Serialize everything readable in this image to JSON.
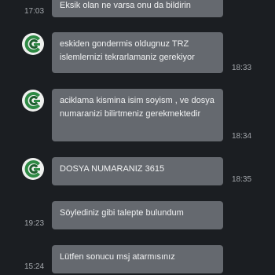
{
  "messages": [
    {
      "direction": "outgoing",
      "text": "Eksik olan ne varsa onu da bildirin",
      "time": "17:03"
    },
    {
      "direction": "incoming",
      "text": "eskiden gondermis oldugnuz TRZ islemlernizi tekrarlamaniz gerekiyor",
      "time": "18:33"
    },
    {
      "direction": "incoming",
      "text": "aciklama kismina isim soyism , ve dosya numaranizi bilirtmeniz gerekmektedir",
      "time": "18:34"
    },
    {
      "direction": "incoming",
      "text": "DOSYA NUMARANIZ 3615",
      "time": "18:35"
    },
    {
      "direction": "outgoing",
      "text": "Söylediniz gibi talepte bulundum",
      "time": "19:23"
    },
    {
      "direction": "outgoing",
      "text": "Lütfen sonucu msj atarmısınız",
      "time": "15:24"
    }
  ],
  "colors": {
    "background": "#1b1e22",
    "bubble": "#65696f",
    "avatar_ring": "#2e8a44"
  },
  "avatar_icon": "green-circular-logo-icon"
}
